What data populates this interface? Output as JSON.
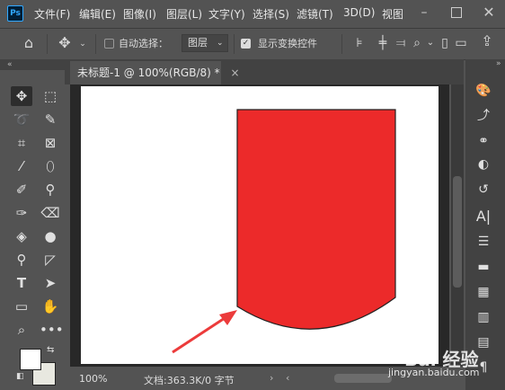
{
  "app": {
    "logo": "Ps"
  },
  "menu": [
    "文件(F)",
    "编辑(E)",
    "图像(I)",
    "图层(L)",
    "文字(Y)",
    "选择(S)",
    "滤镜(T)",
    "3D(D)",
    "视图"
  ],
  "options": {
    "auto_select_label": "自动选择：",
    "auto_select_checked": false,
    "auto_select_value": "图层",
    "show_transform_label": "显示变换控件",
    "show_transform_checked": true
  },
  "document": {
    "tab_title": "未标题-1 @ 100%(RGB/8) *",
    "close_glyph": "×"
  },
  "canvas": {
    "shape_fill": "#ec2a2a",
    "shape_stroke": "#222222",
    "background": "#ffffff",
    "arrow_color": "#ec3b3b"
  },
  "status": {
    "zoom": "100%",
    "doc_info": "文档:363.3K/0 字节"
  },
  "watermark": {
    "main": "Bai 经验",
    "sub": "jingyan.baidu.com"
  },
  "icons": {
    "home": "home-icon",
    "move": "move-icon",
    "marquee": "rect-marquee-icon",
    "lasso": "lasso-icon",
    "quick-select": "quick-select-icon",
    "crop": "crop-icon",
    "frame": "frame-icon",
    "eyedropper": "eyedropper-icon",
    "heal": "spot-heal-icon",
    "brush": "brush-icon",
    "stamp": "clone-stamp-icon",
    "history-brush": "history-brush-icon",
    "eraser": "eraser-icon",
    "bucket": "paint-bucket-icon",
    "blur": "blur-icon",
    "dodge": "dodge-icon",
    "pen": "pen-icon",
    "type": "type-icon",
    "path-select": "path-select-icon",
    "shape": "rectangle-shape-icon",
    "hand": "hand-icon",
    "zoom": "zoom-icon",
    "more": "more-icon"
  }
}
